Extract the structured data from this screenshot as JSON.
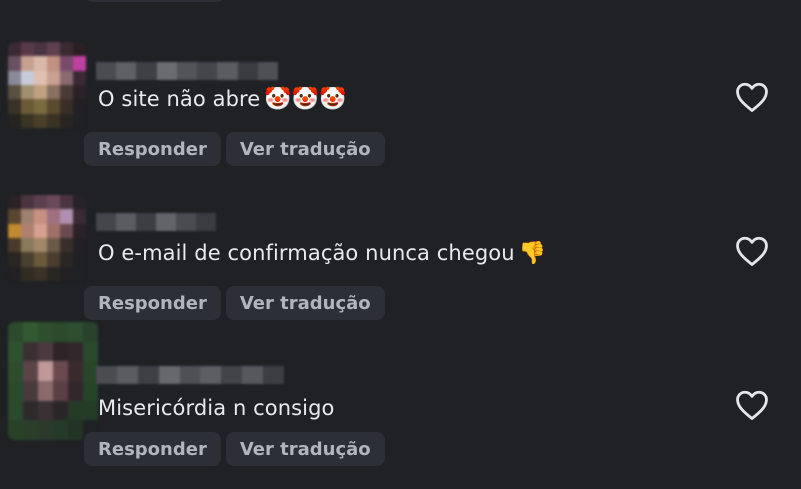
{
  "comments": [
    {
      "text": "O site não abre",
      "emoji": "🤡🤡🤡",
      "reply_label": "Responder",
      "translate_label": "Ver tradução"
    },
    {
      "text": "O e-mail de confirmação nunca chegou",
      "emoji": "👎",
      "reply_label": "Responder",
      "translate_label": "Ver tradução"
    },
    {
      "text": "Misericórdia n consigo",
      "emoji": "",
      "reply_label": "Responder",
      "translate_label": "Ver tradução"
    }
  ],
  "icons": {
    "like": "heart-outline-icon"
  },
  "colors": {
    "background": "#1f2125",
    "chip_background": "#2c2f35",
    "text": "#e9eaee",
    "muted_text": "#b2b5bc"
  }
}
